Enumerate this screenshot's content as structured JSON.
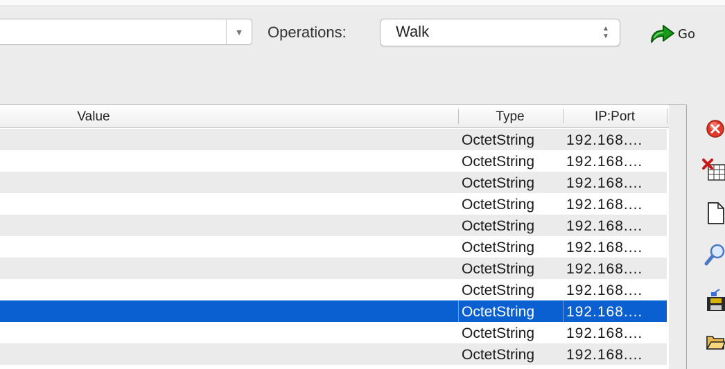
{
  "toolbar": {
    "operations_label": "Operations:",
    "operation_value": "Walk",
    "go_label": "Go"
  },
  "table": {
    "columns": {
      "value": "Value",
      "type": "Type",
      "ip_port": "IP:Port"
    },
    "rows": [
      {
        "type": "OctetString",
        "ip": "192.168....",
        "selected": false
      },
      {
        "type": "OctetString",
        "ip": "192.168....",
        "selected": false
      },
      {
        "type": "OctetString",
        "ip": "192.168....",
        "selected": false
      },
      {
        "type": "OctetString",
        "ip": "192.168....",
        "selected": false
      },
      {
        "type": "OctetString",
        "ip": "192.168....",
        "selected": false
      },
      {
        "type": "OctetString",
        "ip": "192.168....",
        "selected": false
      },
      {
        "type": "OctetString",
        "ip": "192.168....",
        "selected": false
      },
      {
        "type": "OctetString",
        "ip": "192.168....",
        "selected": false
      },
      {
        "type": "OctetString",
        "ip": "192.168....",
        "selected": true
      },
      {
        "type": "OctetString",
        "ip": "192.168....",
        "selected": false
      },
      {
        "type": "OctetString",
        "ip": "192.168....",
        "selected": false
      }
    ]
  },
  "side_toolbar": {
    "icons": [
      "stop-icon",
      "delete-table-icon",
      "new-document-icon",
      "find-icon",
      "save-icon",
      "open-folder-icon"
    ]
  },
  "colors": {
    "selection": "#0a5fd1",
    "row_alt": "#ebebeb",
    "go_arrow": "#1a9a1a"
  }
}
